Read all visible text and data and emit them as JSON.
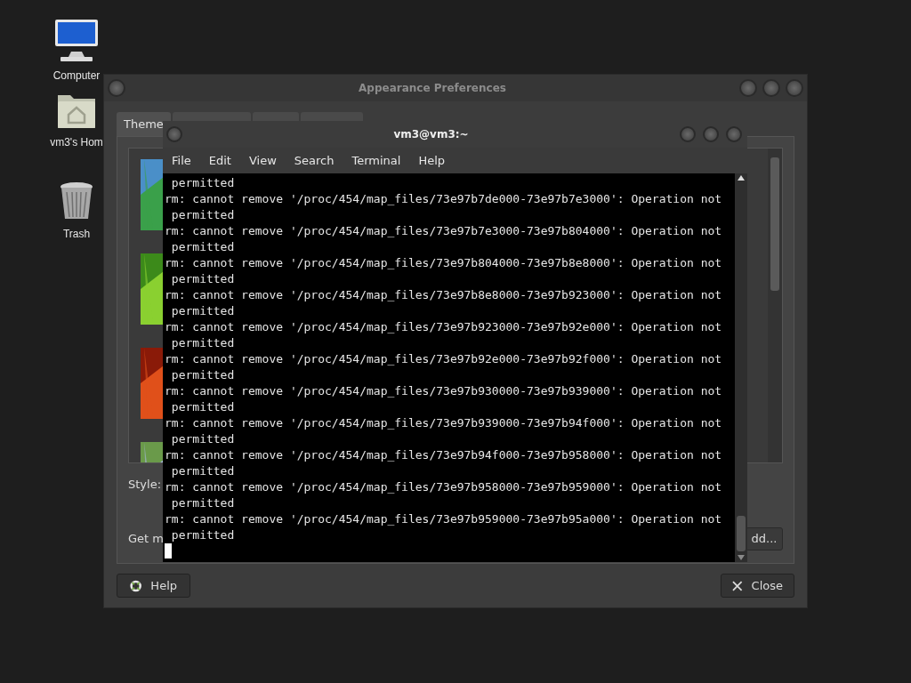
{
  "desktop_icons": [
    {
      "label": "Computer",
      "kind": "computer"
    },
    {
      "label": "vm3's Hom",
      "kind": "home"
    },
    {
      "label": "Trash",
      "kind": "trash"
    }
  ],
  "appearance": {
    "title": "Appearance Preferences",
    "tabs": [
      {
        "label": "Theme",
        "selected": true
      }
    ],
    "style_label": "Style:",
    "get_more_label": "Get m",
    "add_button": "dd...",
    "help_button": "Help",
    "close_button": "Close"
  },
  "terminal": {
    "title": "vm3@vm3:~",
    "menu": [
      "File",
      "Edit",
      "View",
      "Search",
      "Terminal",
      "Help"
    ],
    "lines": [
      " permitted",
      "rm: cannot remove '/proc/454/map_files/73e97b7de000-73e97b7e3000': Operation not",
      " permitted",
      "rm: cannot remove '/proc/454/map_files/73e97b7e3000-73e97b804000': Operation not",
      " permitted",
      "rm: cannot remove '/proc/454/map_files/73e97b804000-73e97b8e8000': Operation not",
      " permitted",
      "rm: cannot remove '/proc/454/map_files/73e97b8e8000-73e97b923000': Operation not",
      " permitted",
      "rm: cannot remove '/proc/454/map_files/73e97b923000-73e97b92e000': Operation not",
      " permitted",
      "rm: cannot remove '/proc/454/map_files/73e97b92e000-73e97b92f000': Operation not",
      " permitted",
      "rm: cannot remove '/proc/454/map_files/73e97b930000-73e97b939000': Operation not",
      " permitted",
      "rm: cannot remove '/proc/454/map_files/73e97b939000-73e97b94f000': Operation not",
      " permitted",
      "rm: cannot remove '/proc/454/map_files/73e97b94f000-73e97b958000': Operation not",
      " permitted",
      "rm: cannot remove '/proc/454/map_files/73e97b958000-73e97b959000': Operation not",
      " permitted",
      "rm: cannot remove '/proc/454/map_files/73e97b959000-73e97b95a000': Operation not",
      " permitted"
    ]
  }
}
